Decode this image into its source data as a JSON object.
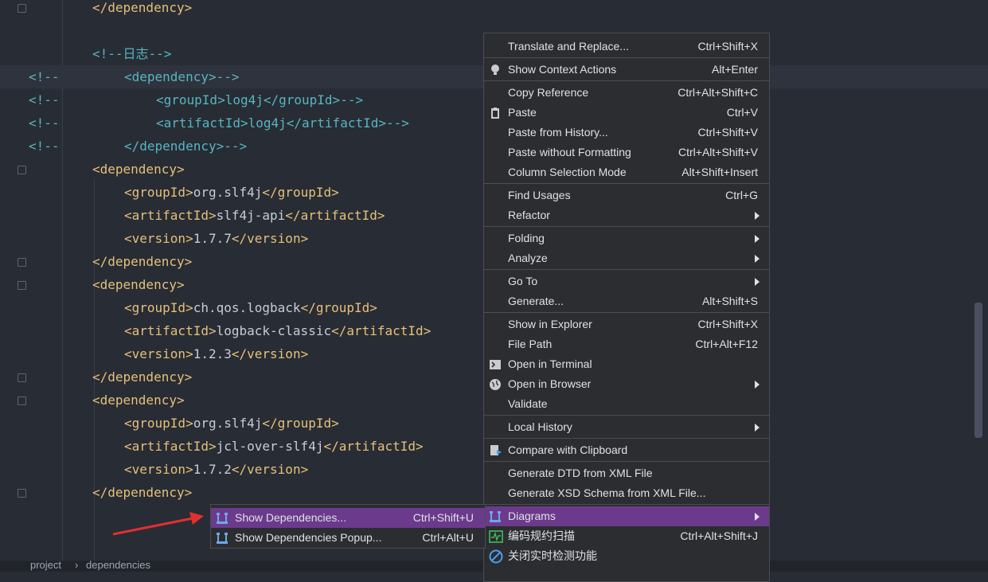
{
  "editor": {
    "lines": [
      {
        "indent": 116,
        "parts": [
          {
            "c": "tag",
            "t": "</dependency>"
          }
        ],
        "fold": true
      },
      {
        "indent": 116,
        "parts": []
      },
      {
        "indent": 116,
        "parts": [
          {
            "c": "xml-comment",
            "t": "<!--日志-->"
          }
        ]
      },
      {
        "indent": 156,
        "prefix": "<!--",
        "hl": true,
        "parts": [
          {
            "c": "xml-comment",
            "t": "<dependency>-->"
          }
        ]
      },
      {
        "indent": 196,
        "prefix": "<!--",
        "parts": [
          {
            "c": "xml-comment",
            "t": "<groupId>log4j</groupId>-->"
          }
        ]
      },
      {
        "indent": 196,
        "prefix": "<!--",
        "parts": [
          {
            "c": "xml-comment",
            "t": "<artifactId>log4j</artifactId>-->"
          }
        ]
      },
      {
        "indent": 156,
        "prefix": "<!--",
        "parts": [
          {
            "c": "xml-comment",
            "t": "</dependency>-->"
          }
        ]
      },
      {
        "indent": 116,
        "parts": [
          {
            "c": "tag",
            "t": "<dependency>"
          }
        ],
        "fold": true
      },
      {
        "indent": 156,
        "parts": [
          {
            "c": "tag",
            "t": "<groupId>"
          },
          {
            "c": "val",
            "t": "org.slf4j"
          },
          {
            "c": "tag",
            "t": "</groupId>"
          }
        ]
      },
      {
        "indent": 156,
        "parts": [
          {
            "c": "tag",
            "t": "<artifactId>"
          },
          {
            "c": "val",
            "t": "slf4j-api"
          },
          {
            "c": "tag",
            "t": "</artifactId>"
          }
        ]
      },
      {
        "indent": 156,
        "parts": [
          {
            "c": "tag",
            "t": "<version>"
          },
          {
            "c": "val",
            "t": "1.7.7"
          },
          {
            "c": "tag",
            "t": "</version>"
          }
        ]
      },
      {
        "indent": 116,
        "parts": [
          {
            "c": "tag",
            "t": "</dependency>"
          }
        ],
        "fold": true
      },
      {
        "indent": 116,
        "parts": [
          {
            "c": "tag",
            "t": "<dependency>"
          }
        ],
        "fold": true
      },
      {
        "indent": 156,
        "parts": [
          {
            "c": "tag",
            "t": "<groupId>"
          },
          {
            "c": "val",
            "t": "ch.qos.logback"
          },
          {
            "c": "tag",
            "t": "</groupId>"
          }
        ]
      },
      {
        "indent": 156,
        "parts": [
          {
            "c": "tag",
            "t": "<artifactId>"
          },
          {
            "c": "val",
            "t": "logback-classic"
          },
          {
            "c": "tag",
            "t": "</artifactId>"
          }
        ]
      },
      {
        "indent": 156,
        "parts": [
          {
            "c": "tag",
            "t": "<version>"
          },
          {
            "c": "val",
            "t": "1.2.3"
          },
          {
            "c": "tag",
            "t": "</version>"
          }
        ]
      },
      {
        "indent": 116,
        "parts": [
          {
            "c": "tag",
            "t": "</dependency>"
          }
        ],
        "fold": true
      },
      {
        "indent": 116,
        "parts": [
          {
            "c": "tag",
            "t": "<dependency>"
          }
        ],
        "fold": true
      },
      {
        "indent": 156,
        "parts": [
          {
            "c": "tag",
            "t": "<groupId>"
          },
          {
            "c": "val",
            "t": "org.slf4j"
          },
          {
            "c": "tag",
            "t": "</groupId>"
          }
        ]
      },
      {
        "indent": 156,
        "parts": [
          {
            "c": "tag",
            "t": "<artifactId>"
          },
          {
            "c": "val",
            "t": "jcl-over-slf4j"
          },
          {
            "c": "tag",
            "t": "</artifactId>"
          }
        ]
      },
      {
        "indent": 156,
        "parts": [
          {
            "c": "tag",
            "t": "<version>"
          },
          {
            "c": "val",
            "t": "1.7.2"
          },
          {
            "c": "tag",
            "t": "</version>"
          }
        ]
      },
      {
        "indent": 116,
        "parts": [
          {
            "c": "tag",
            "t": "</dependency>"
          }
        ],
        "fold": true
      }
    ]
  },
  "breadcrumb": {
    "items": [
      "project",
      "dependencies"
    ],
    "separator": "›"
  },
  "context_menu": {
    "items": [
      {
        "label": "Translate and Replace...",
        "shortcut": "Ctrl+Shift+X"
      },
      {
        "sep": true
      },
      {
        "label": "Show Context Actions",
        "shortcut": "Alt+Enter",
        "icon": "lightbulb-icon"
      },
      {
        "sep": true
      },
      {
        "label": "Copy Reference",
        "shortcut": "Ctrl+Alt+Shift+C"
      },
      {
        "label": "Paste",
        "shortcut": "Ctrl+V",
        "icon": "clipboard-icon"
      },
      {
        "label": "Paste from History...",
        "shortcut": "Ctrl+Shift+V"
      },
      {
        "label": "Paste without Formatting",
        "shortcut": "Ctrl+Alt+Shift+V"
      },
      {
        "label": "Column Selection Mode",
        "shortcut": "Alt+Shift+Insert"
      },
      {
        "sep": true
      },
      {
        "label": "Find Usages",
        "shortcut": "Ctrl+G"
      },
      {
        "label": "Refactor",
        "submenu": true
      },
      {
        "sep": true
      },
      {
        "label": "Folding",
        "submenu": true
      },
      {
        "label": "Analyze",
        "submenu": true
      },
      {
        "sep": true
      },
      {
        "label": "Go To",
        "submenu": true
      },
      {
        "label": "Generate...",
        "shortcut": "Alt+Shift+S"
      },
      {
        "sep": true
      },
      {
        "label": "Show in Explorer",
        "shortcut": "Ctrl+Shift+X"
      },
      {
        "label": "File Path",
        "shortcut": "Ctrl+Alt+F12"
      },
      {
        "label": "Open in Terminal",
        "icon": "terminal-icon"
      },
      {
        "label": "Open in Browser",
        "submenu": true,
        "icon": "globe-icon"
      },
      {
        "label": "Validate"
      },
      {
        "sep": true
      },
      {
        "label": "Local History",
        "submenu": true
      },
      {
        "sep": true
      },
      {
        "label": "Compare with Clipboard",
        "icon": "compare-clipboard-icon"
      },
      {
        "sep": true
      },
      {
        "label": "Generate DTD from XML File"
      },
      {
        "label": "Generate XSD Schema from XML File..."
      },
      {
        "sep": true
      },
      {
        "label": "Diagrams",
        "submenu": true,
        "selected": true,
        "icon": "diagram-icon"
      },
      {
        "label": "编码规约扫描",
        "shortcut": "Ctrl+Alt+Shift+J",
        "icon": "scan-icon"
      },
      {
        "label": "关闭实时检测功能",
        "icon": "no-entry-icon"
      }
    ]
  },
  "diagrams_submenu": {
    "items": [
      {
        "label": "Show Dependencies...",
        "shortcut": "Ctrl+Shift+U",
        "selected": true,
        "icon": "diagram-icon"
      },
      {
        "label": "Show Dependencies Popup...",
        "shortcut": "Ctrl+Alt+U",
        "icon": "diagram-icon"
      }
    ]
  },
  "annotation": {
    "arrow_color": "#e03030"
  },
  "colors": {
    "selection": "#6b3a8c",
    "tag": "#e5c07b",
    "comment": "#56b6c2"
  }
}
